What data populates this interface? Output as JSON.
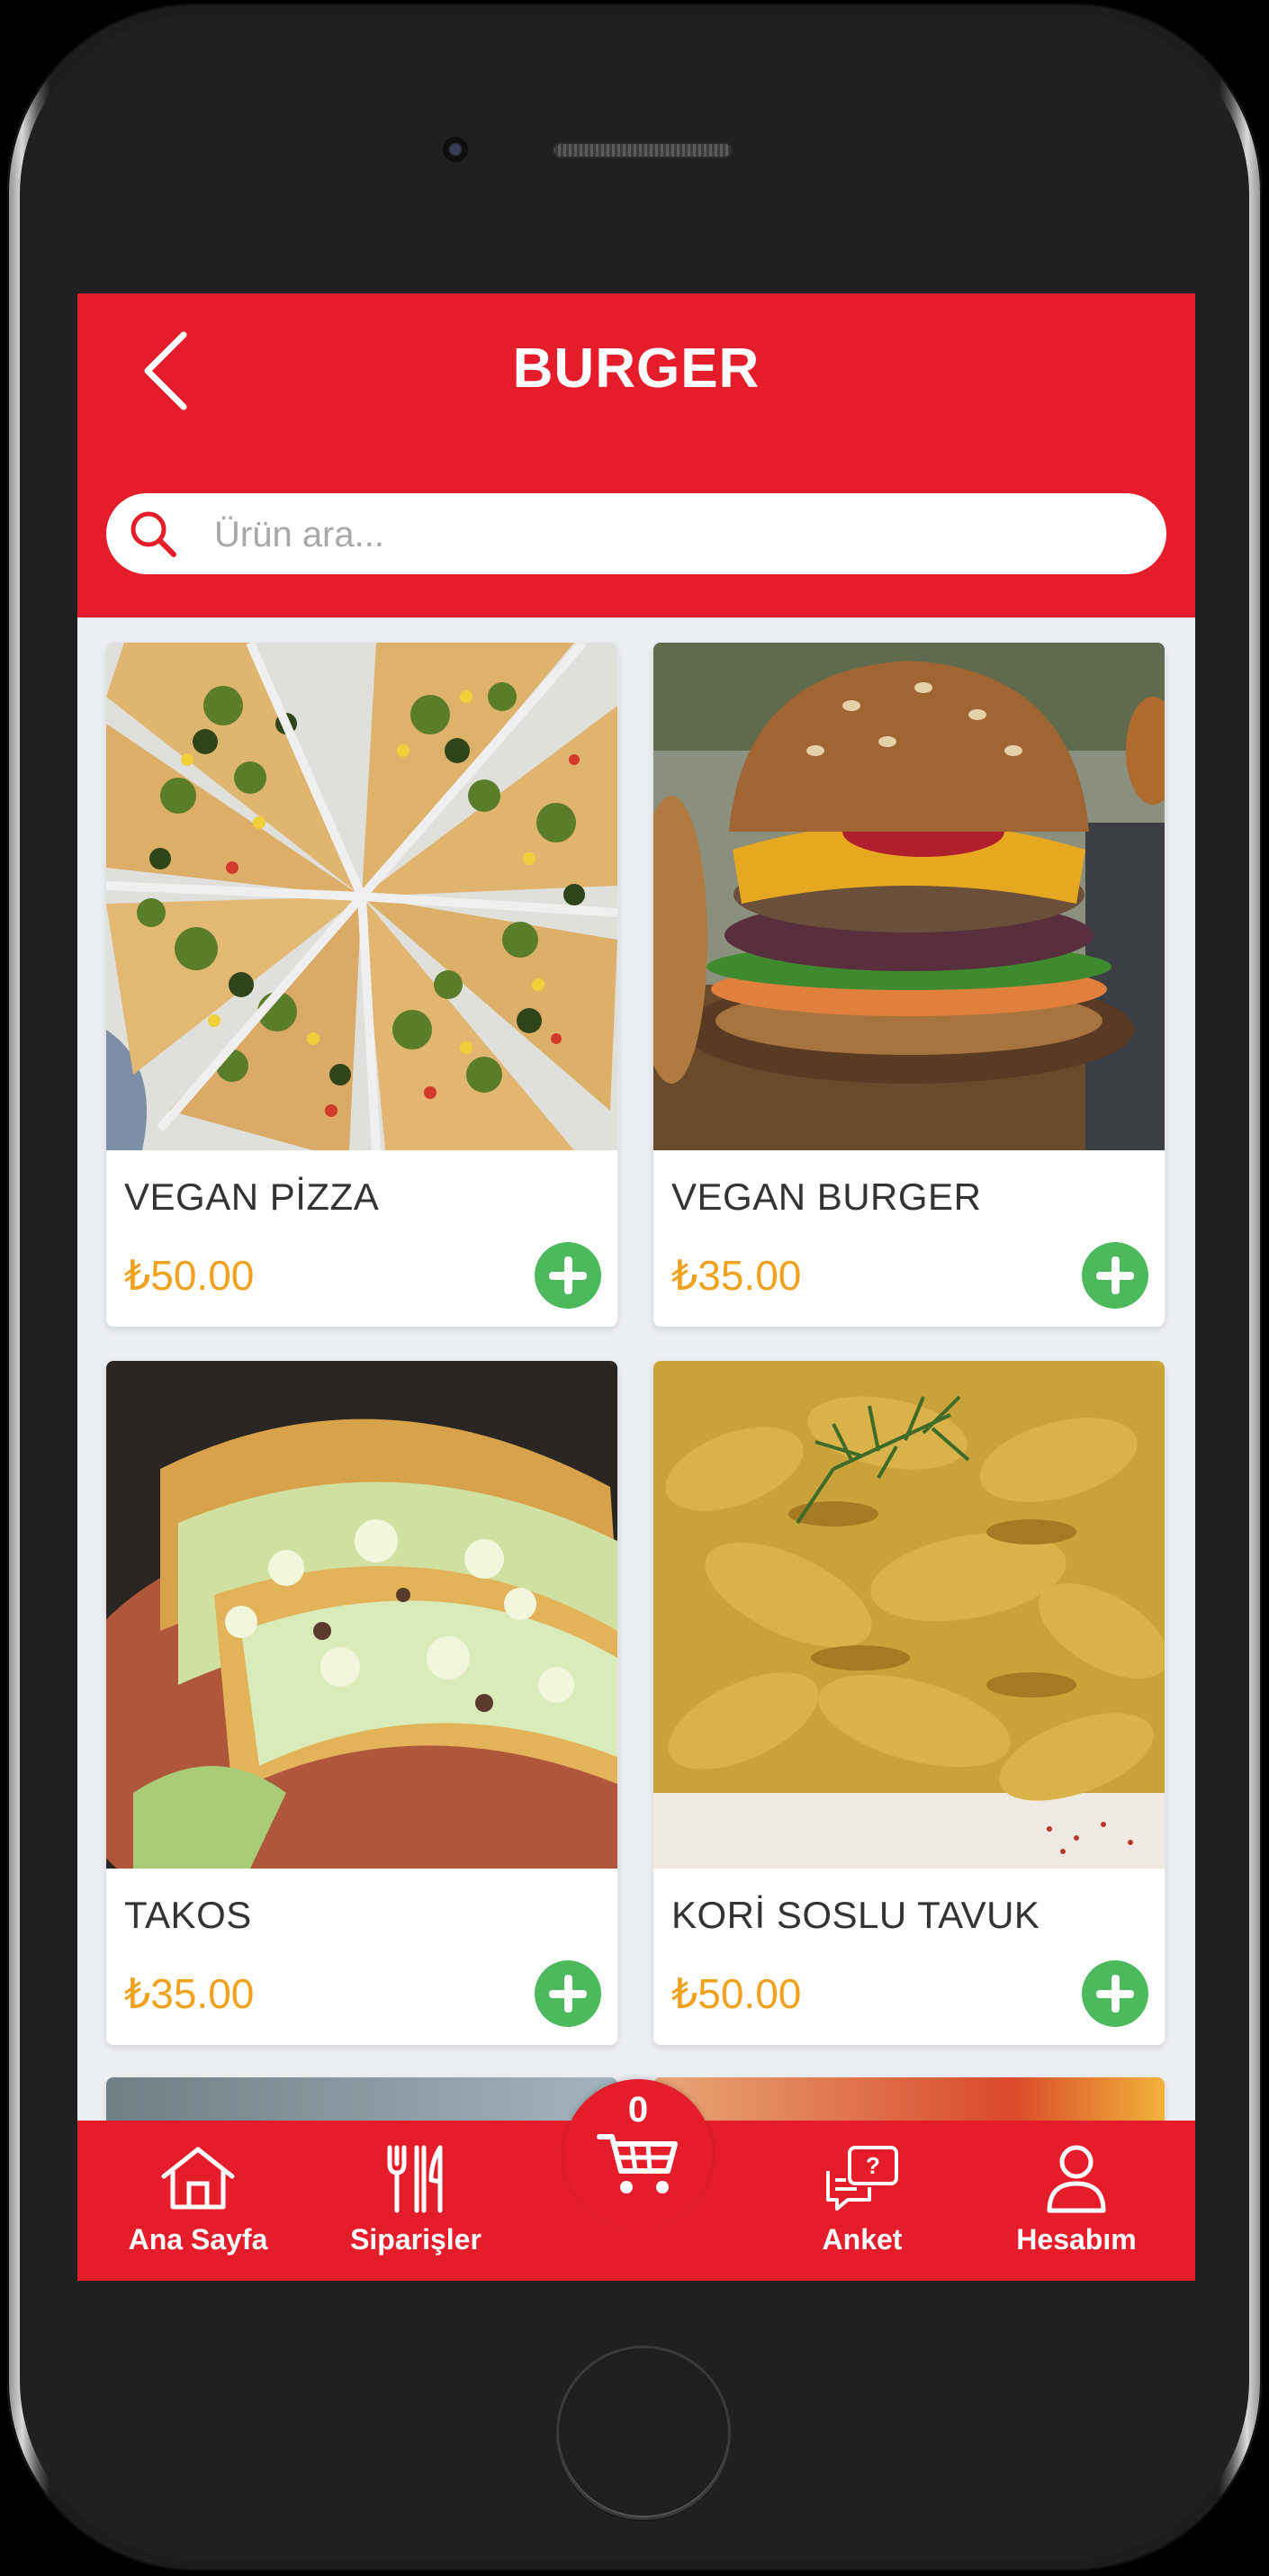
{
  "header": {
    "title": "BURGER",
    "back_icon": "chevron-left-icon"
  },
  "search": {
    "placeholder": "Ürün ara...",
    "icon": "search-icon"
  },
  "products": [
    {
      "name": "VEGAN PİZZA",
      "price": "₺50.00",
      "image": "pizza-photo"
    },
    {
      "name": "VEGAN BURGER",
      "price": "₺35.00",
      "image": "burger-photo"
    },
    {
      "name": "TAKOS",
      "price": "₺35.00",
      "image": "tacos-photo"
    },
    {
      "name": "KORİ SOSLU TAVUK",
      "price": "₺50.00",
      "image": "curry-chicken-photo"
    }
  ],
  "bottom_nav": {
    "items": [
      {
        "label": "Ana Sayfa",
        "icon": "home-icon"
      },
      {
        "label": "Siparişler",
        "icon": "cutlery-icon"
      },
      {
        "label": "Anket",
        "icon": "survey-chat-icon"
      },
      {
        "label": "Hesabım",
        "icon": "user-icon"
      }
    ],
    "cart": {
      "count": "0",
      "icon": "cart-icon"
    }
  },
  "colors": {
    "primary": "#e51d2a",
    "price": "#f0a21f",
    "add_button": "#4cb95c",
    "background": "#eceff2"
  }
}
